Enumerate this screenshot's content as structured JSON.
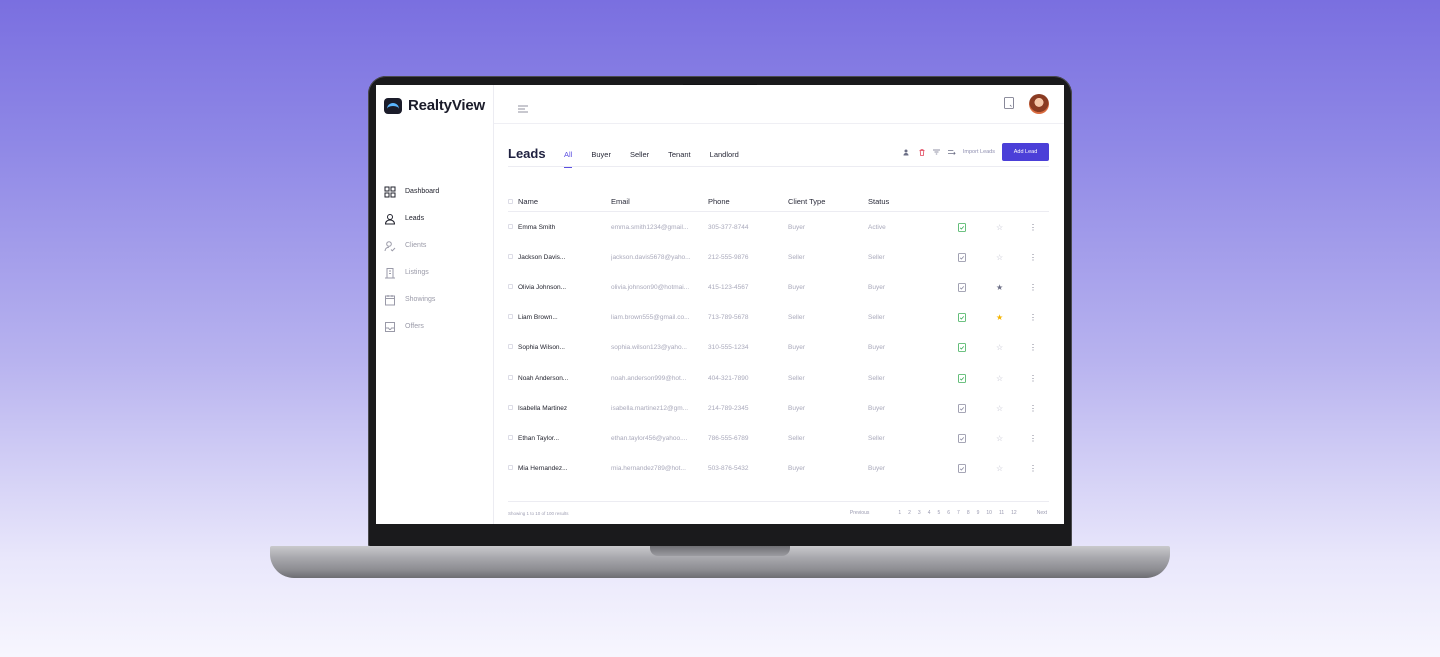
{
  "app": {
    "name": "RealtyView"
  },
  "sidebar": {
    "items": [
      {
        "label": "Dashboard",
        "icon": "grid-icon",
        "active": false
      },
      {
        "label": "Leads",
        "icon": "user-icon",
        "active": true
      },
      {
        "label": "Clients",
        "icon": "user-check-icon",
        "active": false
      },
      {
        "label": "Listings",
        "icon": "building-icon",
        "active": false
      },
      {
        "label": "Showings",
        "icon": "calendar-icon",
        "active": false
      },
      {
        "label": "Offers",
        "icon": "inbox-icon",
        "active": false
      }
    ]
  },
  "header": {
    "title": "Leads",
    "tabs": [
      "All",
      "Buyer",
      "Seller",
      "Tenant",
      "Landlord"
    ],
    "active_tab": "All",
    "import_label": "Import Leads",
    "add_label": "Add Lead"
  },
  "table": {
    "columns": [
      "Name",
      "Email",
      "Phone",
      "Client Type",
      "Status"
    ],
    "rows": [
      {
        "name": "Emma Smith",
        "email": "emma.smith1234@gmail...",
        "phone": "305-377-8744",
        "client_type": "Buyer",
        "status": "Active",
        "doc_color": "green",
        "star": "empty"
      },
      {
        "name": "Jackson Davis...",
        "email": "jackson.davis5678@yaho...",
        "phone": "212-555-9876",
        "client_type": "Seller",
        "status": "Seller",
        "doc_color": "gray",
        "star": "empty"
      },
      {
        "name": "Olivia Johnson...",
        "email": "olivia.johnson90@hotmai...",
        "phone": "415-123-4567",
        "client_type": "Buyer",
        "status": "Buyer",
        "doc_color": "gray",
        "star": "gray"
      },
      {
        "name": "Liam Brown...",
        "email": "liam.brown555@gmail.co...",
        "phone": "713-789-5678",
        "client_type": "Seller",
        "status": "Seller",
        "doc_color": "green",
        "star": "gold"
      },
      {
        "name": "Sophia Wilson...",
        "email": "sophia.wilson123@yaho...",
        "phone": "310-555-1234",
        "client_type": "Buyer",
        "status": "Buyer",
        "doc_color": "green",
        "star": "empty"
      },
      {
        "name": "Noah Anderson...",
        "email": "noah.anderson999@hot...",
        "phone": "404-321-7890",
        "client_type": "Seller",
        "status": "Seller",
        "doc_color": "green",
        "star": "empty"
      },
      {
        "name": "Isabella Martinez",
        "email": "isabella.martinez12@gm...",
        "phone": "214-789-2345",
        "client_type": "Buyer",
        "status": "Buyer",
        "doc_color": "gray",
        "star": "empty"
      },
      {
        "name": "Ethan Taylor...",
        "email": "ethan.taylor456@yahoo....",
        "phone": "786-555-6789",
        "client_type": "Seller",
        "status": "Seller",
        "doc_color": "gray",
        "star": "empty"
      },
      {
        "name": "Mia Hernandez...",
        "email": "mia.hernandez789@hot...",
        "phone": "503-876-5432",
        "client_type": "Buyer",
        "status": "Buyer",
        "doc_color": "gray",
        "star": "empty"
      }
    ]
  },
  "footer": {
    "showing": "Showing 1 to 10 of 100 results",
    "prev": "Previous",
    "pages": [
      "1",
      "2",
      "3",
      "4",
      "5",
      "6",
      "7",
      "8",
      "9",
      "10",
      "11",
      "12"
    ],
    "next": "Next"
  },
  "colors": {
    "accent": "#4b3fd8",
    "green": "#3fae5a",
    "gold": "#f5b400"
  }
}
